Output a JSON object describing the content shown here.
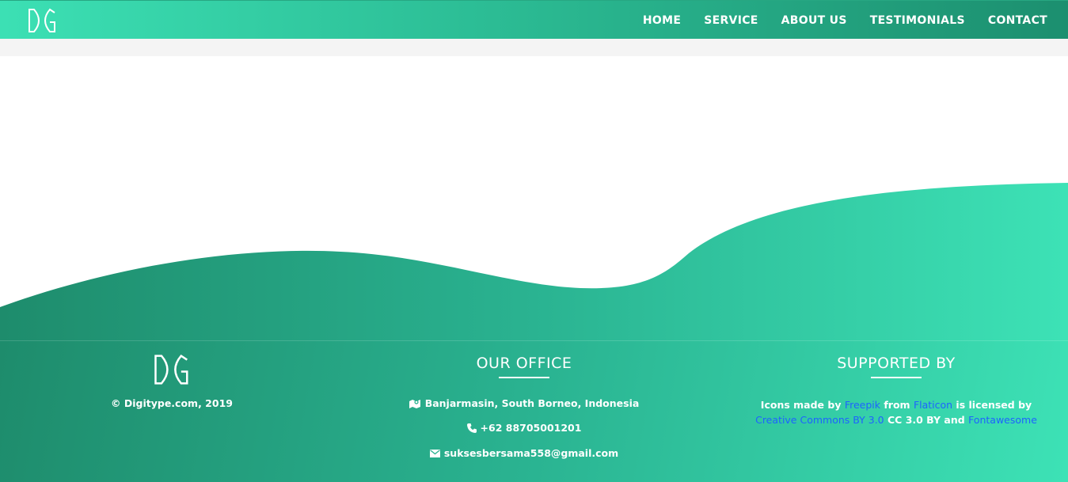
{
  "nav": {
    "brand_logo": "dg-logo",
    "links": [
      "HOME",
      "SERVICE",
      "ABOUT US",
      "TESTIMONIALS",
      "CONTACT"
    ]
  },
  "footer": {
    "brand": {
      "logo": "dg-logo",
      "copyright": "© Digitype.com, 2019"
    },
    "office": {
      "title": "OUR OFFICE",
      "address": "Banjarmasin, South Borneo, Indonesia",
      "address_icon": "map-icon",
      "phone": "+62 88705001201",
      "phone_icon": "phone-icon",
      "email": "suksesbersama558@gmail.com",
      "email_icon": "envelope-icon"
    },
    "support": {
      "title": "SUPPORTED BY",
      "text_1": "Icons made by ",
      "link_freepik": "Freepik",
      "text_2": " from ",
      "link_flaticon": "Flaticon",
      "text_3": " is licensed by",
      "link_cc": "Creative Commons BY 3.0",
      "text_4": " CC 3.0 BY and ",
      "link_fontawesome": "Fontawesome"
    }
  },
  "colors": {
    "accent_light": "#3ce0b4",
    "accent_dark": "#1c8f6f",
    "link": "#1e63ff",
    "band": "#f4f4f4"
  }
}
